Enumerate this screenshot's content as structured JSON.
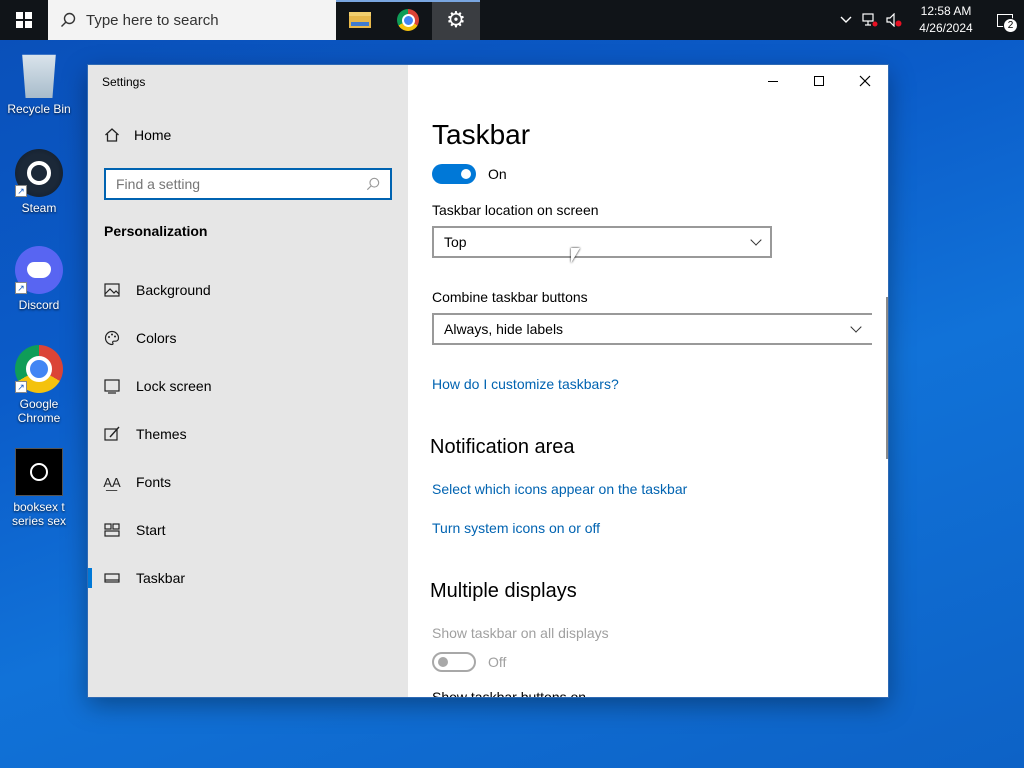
{
  "taskbar": {
    "search_placeholder": "Type here to search",
    "apps": [
      "file-explorer",
      "google-chrome",
      "settings"
    ],
    "clock_time": "12:58 AM",
    "clock_date": "4/26/2024",
    "notification_count": "2"
  },
  "desktop": {
    "icons": [
      {
        "label": "Recycle Bin"
      },
      {
        "label": "Steam"
      },
      {
        "label": "Discord"
      },
      {
        "label": "Google Chrome"
      },
      {
        "label": "booksex t series sex"
      }
    ]
  },
  "window": {
    "title": "Settings",
    "sidebar": {
      "home": "Home",
      "search_placeholder": "Find a setting",
      "section": "Personalization",
      "items": [
        {
          "label": "Background"
        },
        {
          "label": "Colors"
        },
        {
          "label": "Lock screen"
        },
        {
          "label": "Themes"
        },
        {
          "label": "Fonts"
        },
        {
          "label": "Start"
        },
        {
          "label": "Taskbar"
        }
      ],
      "selected": "Taskbar"
    },
    "content": {
      "title": "Taskbar",
      "main_toggle_state": "On",
      "location_label": "Taskbar location on screen",
      "location_value": "Top",
      "combine_label": "Combine taskbar buttons",
      "combine_value": "Always, hide labels",
      "customize_link": "How do I customize taskbars?",
      "notification_heading": "Notification area",
      "notif_link_1": "Select which icons appear on the taskbar",
      "notif_link_2": "Turn system icons on or off",
      "multiple_heading": "Multiple displays",
      "show_all_label": "Show taskbar on all displays",
      "show_all_state": "Off",
      "show_buttons_label": "Show taskbar buttons on"
    }
  },
  "colors": {
    "accent": "#0078d7",
    "link": "#0063b1",
    "taskbar": "#101418"
  }
}
